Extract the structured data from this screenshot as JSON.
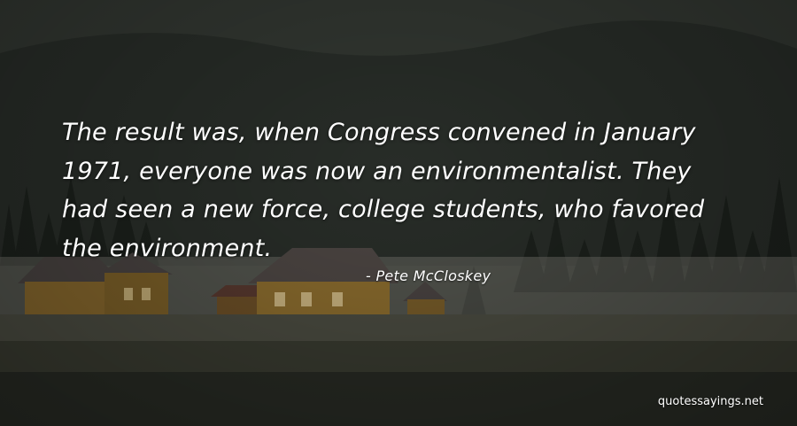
{
  "quote": {
    "lines": [
      "The result was, when Congress convened in January",
      "1971, everyone was now an environmentalist. They",
      "had seen a new force, college students, who favored",
      "the environment."
    ],
    "author": "- Pete McCloskey"
  },
  "watermark": "quotessayings.net",
  "colors": {
    "text": "#ffffff",
    "forest": "#1f241f",
    "cabin_wall": "#8a6a2e",
    "cabin_roof": "#4b4543",
    "field": "#3b3d32"
  },
  "scene": {
    "description_icons": [
      "forest-background",
      "cabin-icon",
      "field-ground"
    ]
  }
}
